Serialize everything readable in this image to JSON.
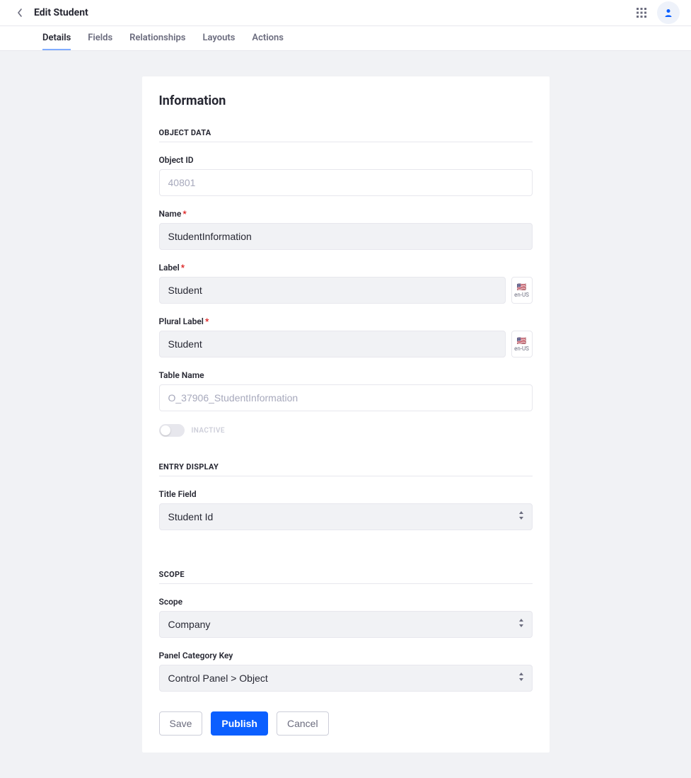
{
  "header": {
    "title": "Edit Student"
  },
  "tabs": [
    {
      "label": "Details",
      "active": true
    },
    {
      "label": "Fields",
      "active": false
    },
    {
      "label": "Relationships",
      "active": false
    },
    {
      "label": "Layouts",
      "active": false
    },
    {
      "label": "Actions",
      "active": false
    }
  ],
  "card": {
    "title": "Information",
    "sections": {
      "object_data": {
        "heading": "OBJECT DATA",
        "object_id": {
          "label": "Object ID",
          "value": "40801"
        },
        "name": {
          "label": "Name",
          "value": "StudentInformation",
          "required": true
        },
        "label": {
          "label": "Label",
          "value": "Student",
          "required": true,
          "locale": "en-US"
        },
        "plural_label": {
          "label": "Plural Label",
          "value": "Student",
          "required": true,
          "locale": "en-US"
        },
        "table_name": {
          "label": "Table Name",
          "value": "O_37906_StudentInformation"
        },
        "active_toggle": {
          "state": false,
          "label": "INACTIVE"
        }
      },
      "entry_display": {
        "heading": "ENTRY DISPLAY",
        "title_field": {
          "label": "Title Field",
          "value": "Student Id"
        }
      },
      "scope": {
        "heading": "SCOPE",
        "scope": {
          "label": "Scope",
          "value": "Company"
        },
        "panel_category_key": {
          "label": "Panel Category Key",
          "value": "Control Panel > Object"
        }
      }
    },
    "buttons": {
      "save": "Save",
      "publish": "Publish",
      "cancel": "Cancel"
    }
  }
}
